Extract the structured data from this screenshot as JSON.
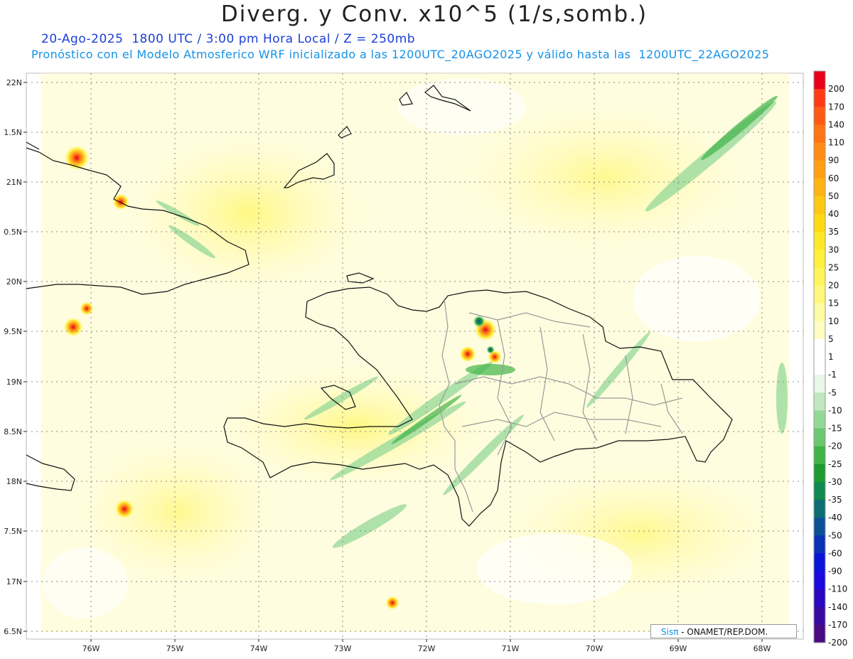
{
  "title": "Diverg. y Conv. x10^5 (1/s,somb.)",
  "subtitle": "20-Ago-2025  1800 UTC / 3:00 pm Hora Local / Z = 250mb",
  "forecast_line": "Pronóstico con el Modelo Atmosferico WRF inicializado a las 1200UTC_20AGO2025 y válido hasta las  1200UTC_22AGO2025",
  "lat_labels": [
    "22N",
    "1.5N",
    "21N",
    "0.5N",
    "20N",
    "9.5N",
    "19N",
    "8.5N",
    "18N",
    "7.5N",
    "17N",
    "6.5N"
  ],
  "lon_labels": [
    "76W",
    "75W",
    "74W",
    "73W",
    "72W",
    "71W",
    "70W",
    "69W",
    "68W"
  ],
  "colorbar": {
    "labels": [
      "200",
      "170",
      "140",
      "110",
      "90",
      "60",
      "50",
      "40",
      "35",
      "30",
      "25",
      "20",
      "15",
      "10",
      "5",
      "1",
      "-1",
      "-5",
      "-10",
      "-15",
      "-20",
      "-25",
      "-30",
      "-35",
      "-40",
      "-50",
      "-60",
      "-90",
      "-110",
      "-140",
      "-170",
      "-200"
    ],
    "colors": [
      "#e8001a",
      "#ff3a14",
      "#ff5a14",
      "#ff7414",
      "#ff8c14",
      "#ffa014",
      "#ffb414",
      "#ffc814",
      "#ffda14",
      "#ffe628",
      "#fff03c",
      "#fff55a",
      "#fff87c",
      "#fffba4",
      "#fffcc4",
      "#ffffff",
      "#ffffff",
      "#e8f7e8",
      "#bfe8c0",
      "#94d898",
      "#6cc870",
      "#40b448",
      "#1c9c30",
      "#108a50",
      "#0c6e74",
      "#0c5096",
      "#0a32b4",
      "#0a14d8",
      "#1a0ae0",
      "#2a08c0",
      "#3a0aa0",
      "#4a0a84"
    ]
  },
  "credit": {
    "logo": "Sisπ",
    "text": "- ONAMET/REP.DOM."
  }
}
